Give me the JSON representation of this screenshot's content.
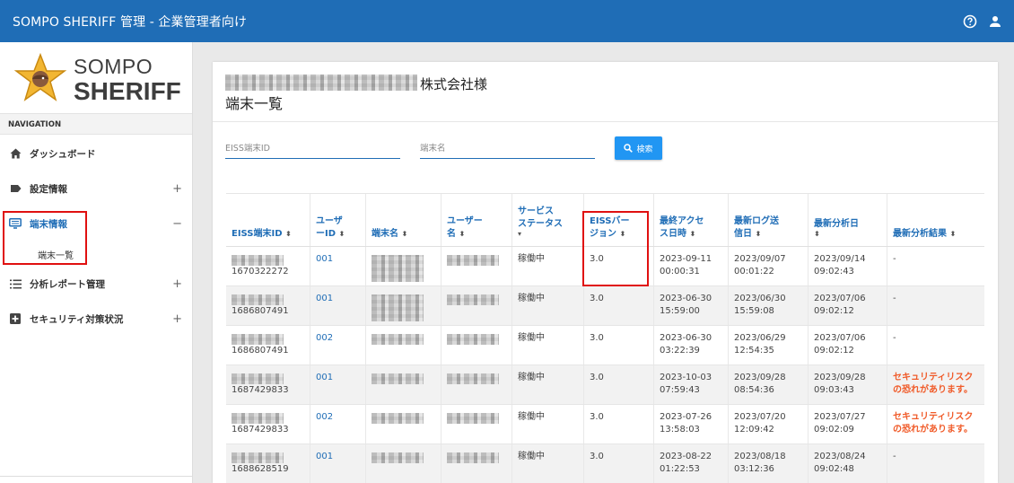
{
  "app": {
    "title": "SOMPO SHERIFF 管理 - 企業管理者向け"
  },
  "topbar_icons": [
    "help-circle-icon",
    "user-icon"
  ],
  "logo": {
    "line1": "SOMPO",
    "line2": "SHERIFF"
  },
  "nav": {
    "header": "NAVIGATION",
    "items": [
      {
        "label": "ダッシュボード",
        "icon": "home-icon",
        "toggle": ""
      },
      {
        "label": "設定情報",
        "icon": "tag-icon",
        "toggle": "+"
      },
      {
        "label": "端末情報",
        "icon": "monitor-icon",
        "toggle": "−"
      },
      {
        "label": "分析レポート管理",
        "icon": "list-icon",
        "toggle": "+"
      },
      {
        "label": "セキュリティ対策状況",
        "icon": "plus-box-icon",
        "toggle": "+"
      }
    ],
    "sub_item": "端末一覧"
  },
  "page": {
    "company_suffix": "株式会社様",
    "title": "端末一覧"
  },
  "filters": {
    "eiss_placeholder": "EISS端末ID",
    "name_placeholder": "端末名",
    "search_label": "検索"
  },
  "table": {
    "headers": [
      {
        "l1": "EISS端末ID",
        "l2": ""
      },
      {
        "l1": "ユーザ",
        "l2": "ーID"
      },
      {
        "l1": "端末名",
        "l2": ""
      },
      {
        "l1": "ユーザー",
        "l2": "名"
      },
      {
        "l1": "サービス",
        "l2": "ステータス"
      },
      {
        "l1": "EISSバー",
        "l2": "ジョン"
      },
      {
        "l1": "最終アクセ",
        "l2": "ス日時"
      },
      {
        "l1": "最新ログ送",
        "l2": "信日"
      },
      {
        "l1": "最新分析日",
        "l2": ""
      },
      {
        "l1": "最新分析結果",
        "l2": ""
      }
    ],
    "rows": [
      {
        "id": "1670322272",
        "user_id": "001",
        "status": "稼働中",
        "version": "3.0",
        "access_date": "2023-09-11",
        "access_time": "00:00:31",
        "log_date": "2023/09/07",
        "log_time": "00:01:22",
        "analysis_date": "2023/09/14",
        "analysis_time": "09:02:43",
        "result_l1": "-",
        "result_l2": ""
      },
      {
        "id": "1686807491",
        "user_id": "001",
        "status": "稼働中",
        "version": "3.0",
        "access_date": "2023-06-30",
        "access_time": "15:59:00",
        "log_date": "2023/06/30",
        "log_time": "15:59:08",
        "analysis_date": "2023/07/06",
        "analysis_time": "09:02:12",
        "result_l1": "-",
        "result_l2": ""
      },
      {
        "id": "1686807491",
        "user_id": "002",
        "status": "稼働中",
        "version": "3.0",
        "access_date": "2023-06-30",
        "access_time": "03:22:39",
        "log_date": "2023/06/29",
        "log_time": "12:54:35",
        "analysis_date": "2023/07/06",
        "analysis_time": "09:02:12",
        "result_l1": "-",
        "result_l2": ""
      },
      {
        "id": "1687429833",
        "user_id": "001",
        "status": "稼働中",
        "version": "3.0",
        "access_date": "2023-10-03",
        "access_time": "07:59:43",
        "log_date": "2023/09/28",
        "log_time": "08:54:36",
        "analysis_date": "2023/09/28",
        "analysis_time": "09:03:43",
        "result_l1": "セキュリティリスク",
        "result_l2": "の恐れがあります。"
      },
      {
        "id": "1687429833",
        "user_id": "002",
        "status": "稼働中",
        "version": "3.0",
        "access_date": "2023-07-26",
        "access_time": "13:58:03",
        "log_date": "2023/07/20",
        "log_time": "12:09:42",
        "analysis_date": "2023/07/27",
        "analysis_time": "09:02:09",
        "result_l1": "セキュリティリスク",
        "result_l2": "の恐れがあります。"
      },
      {
        "id": "1688628519",
        "user_id": "001",
        "status": "稼働中",
        "version": "3.0",
        "access_date": "2023-08-22",
        "access_time": "01:22:53",
        "log_date": "2023/08/18",
        "log_time": "03:12:36",
        "analysis_date": "2023/08/24",
        "analysis_time": "09:02:48",
        "result_l1": "-",
        "result_l2": ""
      }
    ]
  },
  "colors": {
    "brand_blue": "#1f6db6",
    "button_blue": "#2196f3",
    "risk_orange": "#f05a28",
    "highlight_red": "#e01010"
  }
}
